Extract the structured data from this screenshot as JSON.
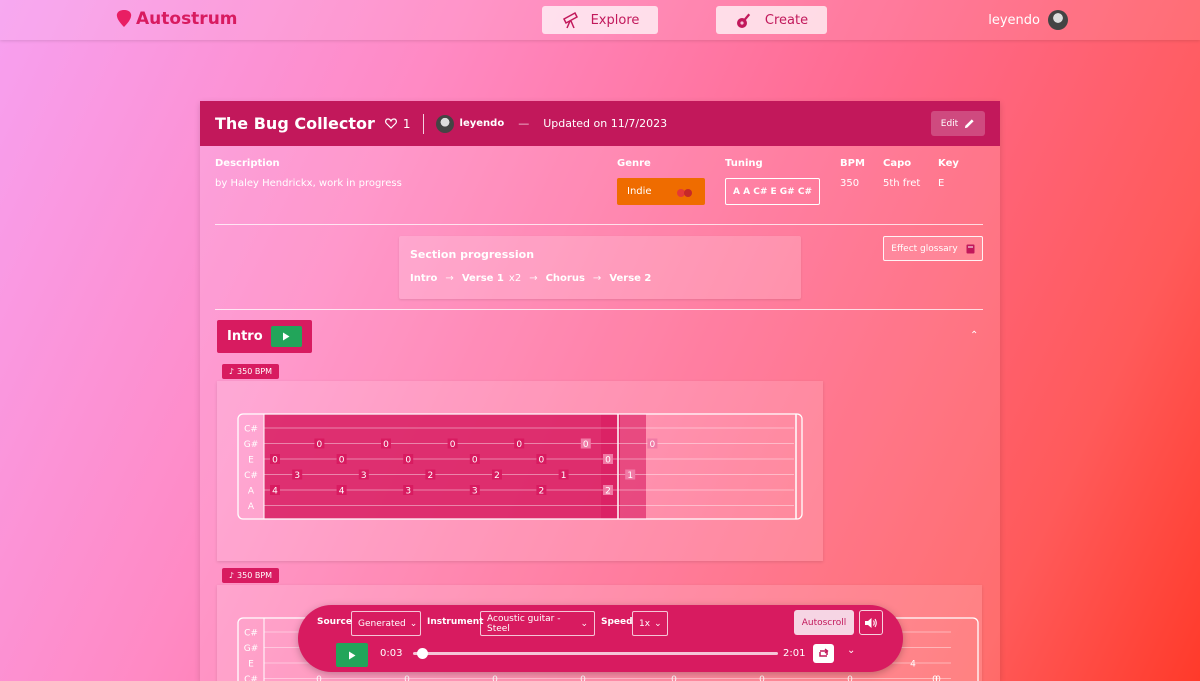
{
  "nav": {
    "brand": "Autostrum",
    "explore_label": "Explore",
    "create_label": "Create",
    "username": "leyendo"
  },
  "song": {
    "title": "The Bug Collector",
    "likes": "1",
    "owner": "leyendo",
    "dash": "—",
    "updated": "Updated on 11/7/2023",
    "edit_label": "Edit",
    "description_label": "Description",
    "description": "by Haley Hendrickx, work in progress",
    "genre_label": "Genre",
    "genre": "Indie",
    "tuning_label": "Tuning",
    "tuning": "A A C# E G# C#",
    "bpm_label": "BPM",
    "bpm": "350",
    "capo_label": "Capo",
    "capo": "5th fret",
    "key_label": "Key",
    "key": "E"
  },
  "progression": {
    "title": "Section progression",
    "items": [
      {
        "name": "Intro",
        "mult": ""
      },
      {
        "name": "Verse 1",
        "mult": "x2"
      },
      {
        "name": "Chorus",
        "mult": ""
      },
      {
        "name": "Verse 2",
        "mult": ""
      }
    ],
    "arrow": "→"
  },
  "glossary_label": "Effect glossary",
  "section": {
    "name": "Intro",
    "collapse_icon": "chevron-up-icon"
  },
  "tab1": {
    "bpm_badge": "350 BPM",
    "strings": [
      "C#",
      "G#",
      "E",
      "C#",
      "A",
      "A"
    ],
    "notes": [
      {
        "col": 0,
        "string": 2,
        "fret": "0"
      },
      {
        "col": 0,
        "string": 4,
        "fret": "4"
      },
      {
        "col": 1,
        "string": 3,
        "fret": "3"
      },
      {
        "col": 2,
        "string": 1,
        "fret": "0"
      },
      {
        "col": 3,
        "string": 2,
        "fret": "0"
      },
      {
        "col": 3,
        "string": 4,
        "fret": "4"
      },
      {
        "col": 4,
        "string": 3,
        "fret": "3"
      },
      {
        "col": 5,
        "string": 1,
        "fret": "0"
      },
      {
        "col": 6,
        "string": 2,
        "fret": "0"
      },
      {
        "col": 6,
        "string": 4,
        "fret": "3"
      },
      {
        "col": 7,
        "string": 3,
        "fret": "2"
      },
      {
        "col": 8,
        "string": 1,
        "fret": "0"
      },
      {
        "col": 9,
        "string": 2,
        "fret": "0"
      },
      {
        "col": 9,
        "string": 4,
        "fret": "3"
      },
      {
        "col": 10,
        "string": 3,
        "fret": "2"
      },
      {
        "col": 11,
        "string": 1,
        "fret": "0"
      },
      {
        "col": 12,
        "string": 2,
        "fret": "0"
      },
      {
        "col": 12,
        "string": 4,
        "fret": "2"
      },
      {
        "col": 13,
        "string": 3,
        "fret": "1"
      },
      {
        "col": 14,
        "string": 1,
        "fret": "0"
      },
      {
        "col": 15,
        "string": 2,
        "fret": "0"
      },
      {
        "col": 15,
        "string": 4,
        "fret": "2"
      },
      {
        "col": 16,
        "string": 3,
        "fret": "1"
      },
      {
        "col": 17,
        "string": 1,
        "fret": "0"
      }
    ]
  },
  "tab2": {
    "bpm_badge": "350 BPM",
    "strings": [
      "C#",
      "G#",
      "E",
      "C#"
    ],
    "visible_frets": [
      "0",
      "0",
      "0",
      "0",
      "0",
      "0",
      "0",
      "0",
      "4",
      "0"
    ]
  },
  "player": {
    "source_label": "Source",
    "source_value": "Generated",
    "instrument_label": "Instrument",
    "instrument_value": "Acoustic guitar - Steel",
    "speed_label": "Speed",
    "speed_value": "1x",
    "autoscroll_label": "Autoscroll",
    "current_time": "0:03",
    "total_time": "2:01",
    "progress": 0.025
  },
  "colors": {
    "primary": "#c2185b",
    "accent": "#d81b60",
    "play_green": "#22a55a",
    "genre_orange": "#ef6c00"
  }
}
